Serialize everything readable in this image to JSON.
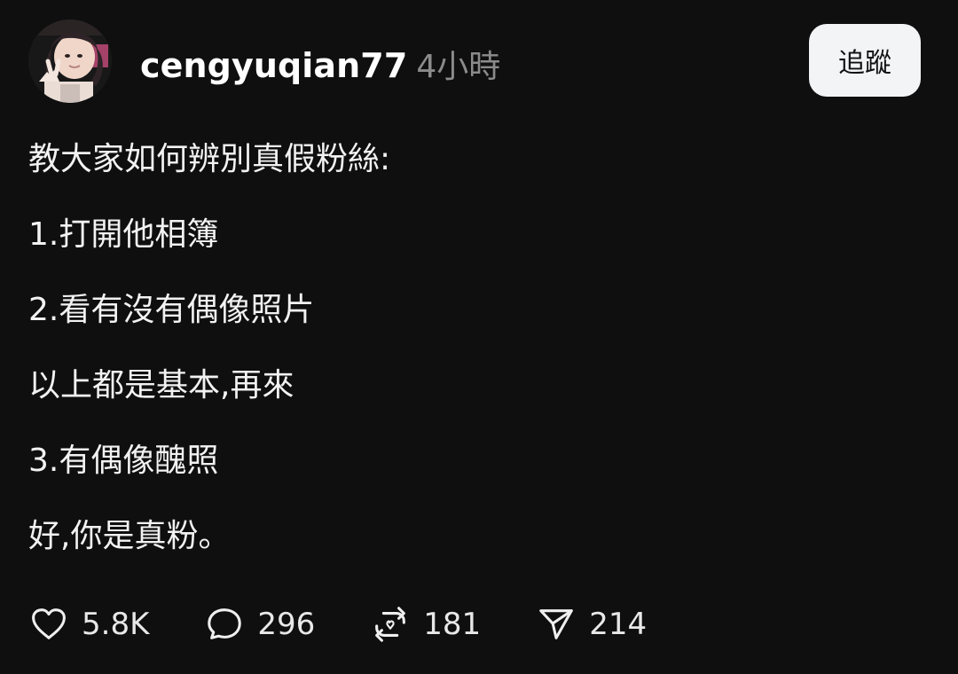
{
  "post": {
    "username": "cengyuqian77",
    "time": "4小時",
    "follow_label": "追蹤",
    "lines": [
      "教大家如何辨別真假粉絲:",
      "1.打開他相簿",
      "2.看有沒有偶像照片",
      "以上都是基本,再來",
      "3.有偶像醜照",
      "好,你是真粉。"
    ],
    "stats": {
      "likes": "5.8K",
      "comments": "296",
      "reposts": "181",
      "shares": "214"
    }
  },
  "icons": {
    "avatar": "profile-photo",
    "like": "heart-icon",
    "comment": "comment-bubble-icon",
    "repost": "repost-icon",
    "share": "send-icon"
  },
  "colors": {
    "background": "#0f0f10",
    "text": "#f2f2f2",
    "muted": "#8b8b8b",
    "button": "#f2f4f6"
  }
}
